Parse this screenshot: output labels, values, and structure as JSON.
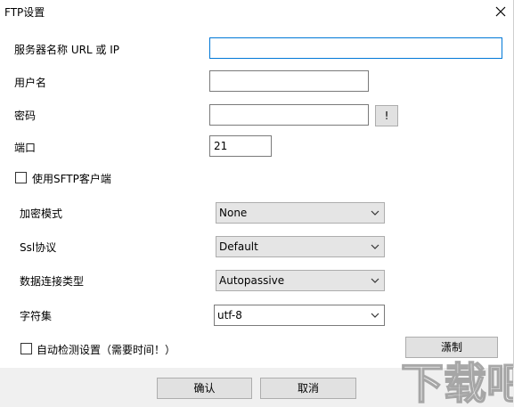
{
  "window": {
    "title": "FTP设置"
  },
  "fields": {
    "server": {
      "label": "服务器名称 URL 或 IP",
      "value": ""
    },
    "username": {
      "label": "用户名",
      "value": ""
    },
    "password": {
      "label": "密码",
      "value": "",
      "button": "!"
    },
    "port": {
      "label": "端口",
      "value": "21"
    }
  },
  "sftp": {
    "label": "使用SFTP客户端",
    "checked": false
  },
  "options": {
    "encryption": {
      "label": "加密模式",
      "value": "None"
    },
    "ssl": {
      "label": "Ssl协议",
      "value": "Default"
    },
    "connection": {
      "label": "数据连接类型",
      "value": "Autopassive"
    },
    "charset": {
      "label": "字符集",
      "value": "utf-8"
    }
  },
  "autodetect": {
    "label": "自动检测设置（需要时间！）",
    "checked": false,
    "button": "潇制"
  },
  "footer": {
    "ok": "确认",
    "cancel": "取消"
  },
  "watermark": {
    "text": "下载吧"
  }
}
